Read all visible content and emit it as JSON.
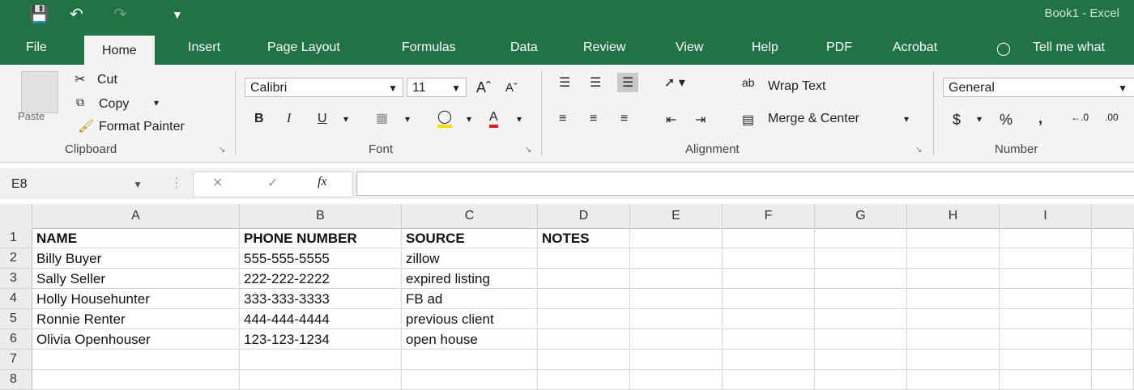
{
  "window": {
    "title": "Book1  -  Excel"
  },
  "tabs": [
    "File",
    "Home",
    "Insert",
    "Page Layout",
    "Formulas",
    "Data",
    "Review",
    "View",
    "Help",
    "PDF",
    "Acrobat"
  ],
  "tell_me": "Tell me what",
  "clipboard": {
    "paste": "Paste",
    "cut": "Cut",
    "copy": "Copy",
    "format_painter": "Format Painter",
    "label": "Clipboard"
  },
  "font": {
    "family": "Calibri",
    "size": "11",
    "bold": "B",
    "italic": "I",
    "underline": "U",
    "label": "Font"
  },
  "alignment": {
    "wrap": "Wrap Text",
    "merge": "Merge & Center",
    "label": "Alignment"
  },
  "number": {
    "format": "General",
    "currency": "$",
    "percent": "%",
    "comma": ",",
    "label": "Number"
  },
  "formula_bar": {
    "name_box": "E8",
    "fx": "fx",
    "value": ""
  },
  "columns": [
    "A",
    "B",
    "C",
    "D",
    "E",
    "F",
    "G",
    "H",
    "I"
  ],
  "rows": [
    {
      "num": "1",
      "cells": [
        "NAME",
        "PHONE NUMBER",
        "SOURCE",
        "NOTES"
      ],
      "bold": true
    },
    {
      "num": "2",
      "cells": [
        "Billy Buyer",
        "555-555-5555",
        "zillow",
        ""
      ]
    },
    {
      "num": "3",
      "cells": [
        "Sally Seller",
        "222-222-2222",
        "expired listing",
        ""
      ]
    },
    {
      "num": "4",
      "cells": [
        "Holly Househunter",
        "333-333-3333",
        "FB ad",
        ""
      ]
    },
    {
      "num": "5",
      "cells": [
        "Ronnie Renter",
        "444-444-4444",
        "previous client",
        ""
      ]
    },
    {
      "num": "6",
      "cells": [
        "Olivia Openhouser",
        "123-123-1234",
        "open house",
        ""
      ]
    },
    {
      "num": "7",
      "cells": [
        "",
        "",
        "",
        ""
      ]
    },
    {
      "num": "8",
      "cells": [
        "",
        "",
        "",
        ""
      ]
    }
  ]
}
